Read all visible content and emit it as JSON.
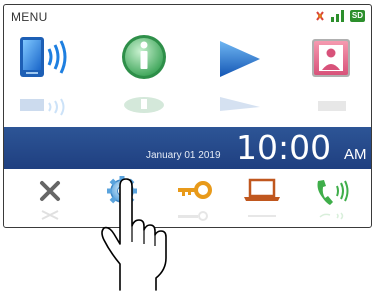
{
  "header": {
    "menu_label": "MENU",
    "sd_label": "SD",
    "icons": [
      "no-alert-icon",
      "signal-strength-icon",
      "sd-card-icon"
    ]
  },
  "top_buttons": [
    {
      "name": "phone-wireless-icon"
    },
    {
      "name": "info-icon"
    },
    {
      "name": "play-icon"
    },
    {
      "name": "contact-card-icon"
    }
  ],
  "clock": {
    "date": "January 01 2019",
    "time": "10:00",
    "ampm": "AM"
  },
  "bottom_buttons": [
    {
      "name": "close-icon"
    },
    {
      "name": "settings-gear-icon"
    },
    {
      "name": "key-icon"
    },
    {
      "name": "laptop-icon"
    },
    {
      "name": "handset-signal-icon"
    }
  ],
  "colors": {
    "clock_bar": "#2d5596",
    "accent_green": "#2c8f2c",
    "accent_blue": "#1e6fd0",
    "key_orange": "#e89a1a",
    "contact_pink": "#e8728f"
  }
}
